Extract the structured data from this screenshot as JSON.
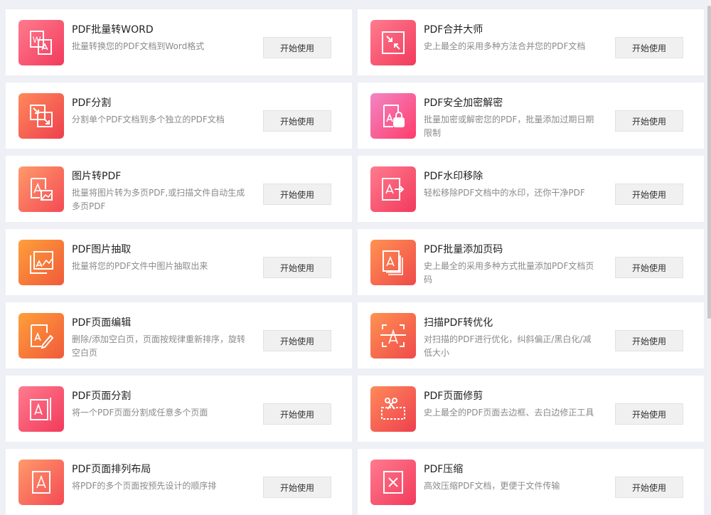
{
  "button_label": "开始使用",
  "tools": [
    {
      "title": "PDF批量转WORD",
      "desc": "批量转换您的PDF文档到Word格式",
      "icon": "word-convert-icon"
    },
    {
      "title": "PDF合并大师",
      "desc": "史上最全的采用多种方法合并您的PDF文档",
      "icon": "merge-icon"
    },
    {
      "title": "PDF分割",
      "desc": "分割单个PDF文档到多个独立的PDF文档",
      "icon": "split-icon"
    },
    {
      "title": "PDF安全加密解密",
      "desc": "批量加密或解密您的PDF，批量添加过期日期限制",
      "icon": "lock-icon"
    },
    {
      "title": "图片转PDF",
      "desc": "批量将图片转为多页PDF,或扫描文件自动生成多页PDF",
      "icon": "image-to-pdf-icon"
    },
    {
      "title": "PDF水印移除",
      "desc": "轻松移除PDF文档中的水印，还你干净PDF",
      "icon": "watermark-remove-icon"
    },
    {
      "title": "PDF图片抽取",
      "desc": "批量将您的PDF文件中图片抽取出来",
      "icon": "image-extract-icon"
    },
    {
      "title": "PDF批量添加页码",
      "desc": "史上最全的采用多种方式批量添加PDF文档页码",
      "icon": "page-number-icon"
    },
    {
      "title": "PDF页面编辑",
      "desc": "删除/添加空白页，页面按规律重新排序，旋转空白页",
      "icon": "page-edit-icon"
    },
    {
      "title": "扫描PDF转优化",
      "desc": "对扫描的PDF进行优化，纠斜偏正/黑白化/减低大小",
      "icon": "scan-optimize-icon"
    },
    {
      "title": "PDF页面分割",
      "desc": "将一个PDF页面分割成任意多个页面",
      "icon": "page-split-icon"
    },
    {
      "title": "PDF页面修剪",
      "desc": "史上最全的PDF页面去边框、去白边修正工具",
      "icon": "page-crop-icon"
    },
    {
      "title": "PDF页面排列布局",
      "desc": "将PDF的多个页面按预先设计的顺序排",
      "icon": "page-layout-icon"
    },
    {
      "title": "PDF压缩",
      "desc": "高效压缩PDF文档，更便于文件传输",
      "icon": "compress-icon"
    }
  ]
}
